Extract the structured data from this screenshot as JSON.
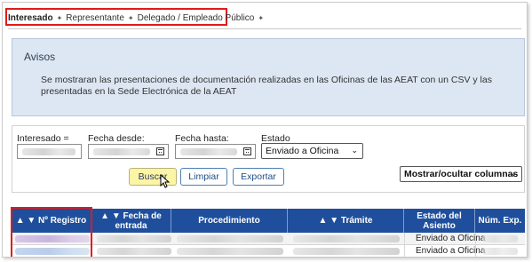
{
  "tabs": [
    {
      "label": "Interesado",
      "active": true
    },
    {
      "label": "Representante",
      "active": false
    },
    {
      "label": "Delegado / Empleado Público",
      "active": false
    }
  ],
  "tab_separator": "✦",
  "avisos": {
    "title": "Avisos",
    "text": "Se mostraran las presentaciones de documentación realizadas en las Oficinas de las AEAT con un CSV y las presentadas en la Sede Electrónica de la AEAT"
  },
  "filters": {
    "interesado_label": "Interesado =",
    "fecha_desde_label": "Fecha desde:",
    "fecha_hasta_label": "Fecha hasta:",
    "estado_label": "Estado",
    "estado_value": "Enviado a Oficina",
    "columns_toggle": "Mostrar/ocultar columnas"
  },
  "buttons": {
    "buscar": "Buscar",
    "limpiar": "Limpiar",
    "exportar": "Exportar"
  },
  "table": {
    "headers": [
      "▲ ▼  Nº Registro",
      "▲ ▼  Fecha de entrada",
      "Procedimiento",
      "▲ ▼  Trámite",
      "Estado del Asiento",
      "Núm. Exp."
    ],
    "rows": [
      {
        "estado": "Enviado a Oficina"
      },
      {
        "estado": "Enviado a Oficina"
      }
    ]
  },
  "colors": {
    "accent": "#1f4f9c",
    "highlight": "#e21a1a",
    "notice_bg": "#dde7f3",
    "primary_button": "#fdf5a6"
  },
  "icons": {
    "date_picker": "calendar-icon",
    "pointer": "mouse-pointer-icon",
    "dropdown": "chevron-down-icon"
  }
}
